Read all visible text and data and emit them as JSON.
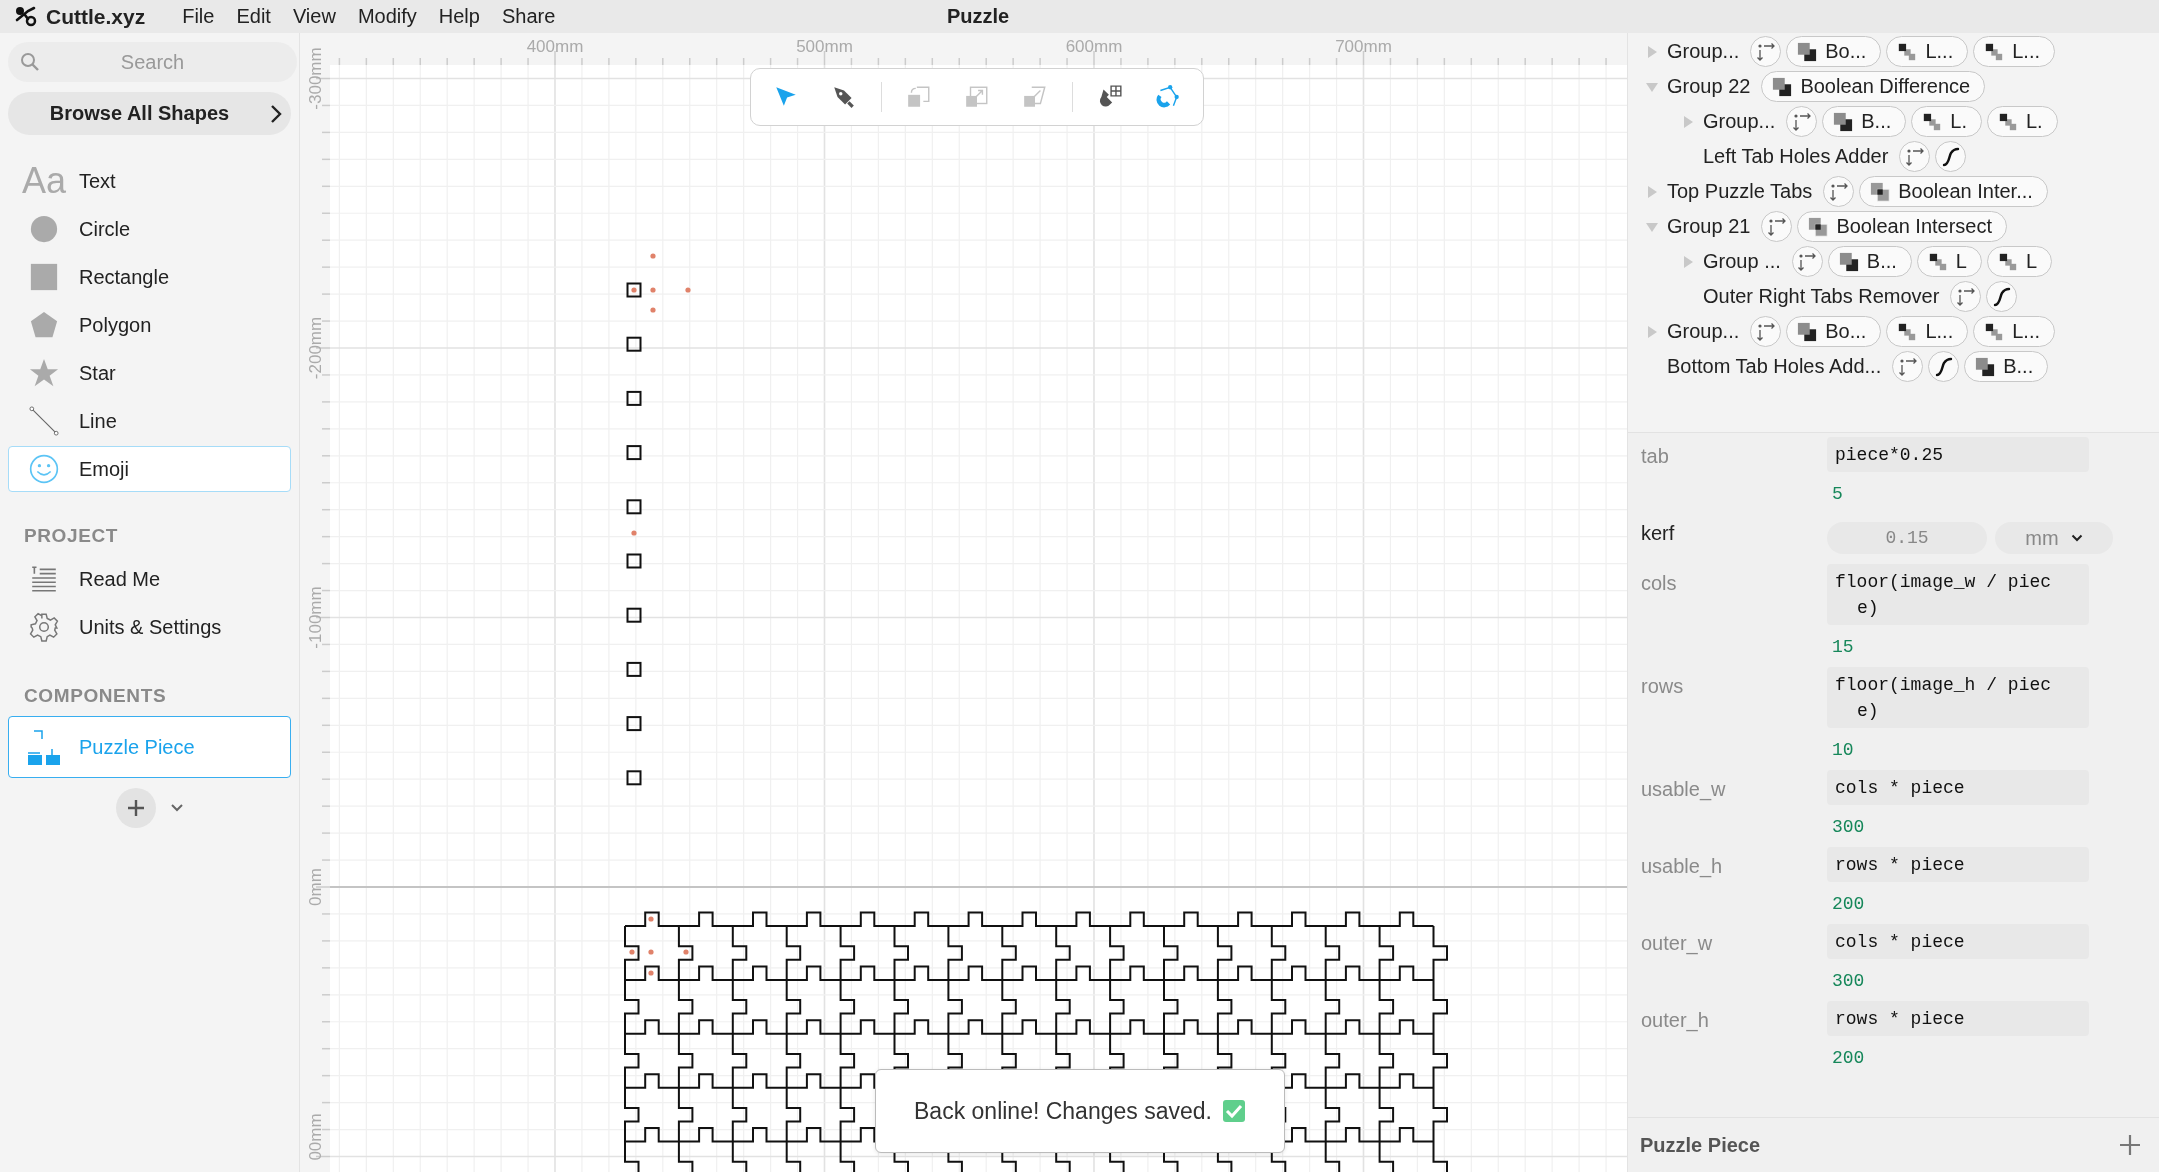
{
  "menu_bar": {
    "app_name": "Cuttle.xyz",
    "menus": [
      "File",
      "Edit",
      "View",
      "Modify",
      "Help",
      "Share"
    ],
    "title": "Puzzle"
  },
  "sidebar": {
    "search": {
      "placeholder": "Search"
    },
    "browse_button": "Browse All Shapes",
    "shapes": [
      {
        "kind": "text",
        "glyph": "Aa",
        "label": "Text",
        "selected": false
      },
      {
        "kind": "circle",
        "label": "Circle",
        "selected": false
      },
      {
        "kind": "rectangle",
        "label": "Rectangle",
        "selected": false
      },
      {
        "kind": "polygon",
        "label": "Polygon",
        "selected": false
      },
      {
        "kind": "star",
        "label": "Star",
        "selected": false
      },
      {
        "kind": "line",
        "label": "Line",
        "selected": false
      },
      {
        "kind": "emoji",
        "label": "Emoji",
        "selected": true
      }
    ],
    "project_heading": "PROJECT",
    "project_items": [
      {
        "kind": "readme",
        "label": "Read Me"
      },
      {
        "kind": "settings",
        "label": "Units & Settings"
      }
    ],
    "components_heading": "COMPONENTS",
    "components": [
      {
        "label": "Puzzle Piece",
        "selected": true
      }
    ]
  },
  "canvas": {
    "ruler_x": [
      "400mm",
      "500mm",
      "600mm",
      "700mm"
    ],
    "ruler_y": [
      "-300mm",
      "-200mm",
      "-100mm",
      "0mm",
      "00mm"
    ],
    "toolbar": [
      {
        "kind": "select",
        "selected": true
      },
      {
        "kind": "pen",
        "selected": false
      },
      {
        "kind": "separator"
      },
      {
        "kind": "rotate-copy",
        "disabled": true
      },
      {
        "kind": "scale-copy",
        "disabled": true
      },
      {
        "kind": "skew-copy",
        "disabled": true
      },
      {
        "kind": "separator"
      },
      {
        "kind": "snap-grid",
        "on": false
      },
      {
        "kind": "snap-points",
        "on": true
      }
    ],
    "toast": {
      "message": "Back online! Changes saved."
    }
  },
  "tree": [
    {
      "name": "Group...",
      "expanded": false,
      "chips": [
        {
          "kind": "swap"
        },
        {
          "kind": "difference",
          "label": "Bo..."
        },
        {
          "kind": "repeat",
          "label": "L..."
        },
        {
          "kind": "repeat",
          "label": "L..."
        }
      ]
    },
    {
      "name": "Group 22",
      "expanded": true,
      "chips": [
        {
          "kind": "difference",
          "label": "Boolean Difference"
        }
      ],
      "children": [
        {
          "name": "Group...",
          "expanded": false,
          "chips": [
            {
              "kind": "swap"
            },
            {
              "kind": "difference",
              "label": "B..."
            },
            {
              "kind": "repeat",
              "label": "L."
            },
            {
              "kind": "repeat",
              "label": "L."
            }
          ]
        },
        {
          "name": "Left Tab Holes Adder",
          "chips": [
            {
              "kind": "swap"
            },
            {
              "kind": "curve"
            }
          ]
        }
      ]
    },
    {
      "name": "Top Puzzle Tabs",
      "expanded": false,
      "chips": [
        {
          "kind": "swap"
        },
        {
          "kind": "intersect",
          "label": "Boolean Inter..."
        }
      ]
    },
    {
      "name": "Group 21",
      "expanded": true,
      "chips": [
        {
          "kind": "swap"
        },
        {
          "kind": "intersect",
          "label": "Boolean Intersect"
        }
      ],
      "children": [
        {
          "name": "Group ...",
          "expanded": false,
          "chips": [
            {
              "kind": "swap"
            },
            {
              "kind": "difference",
              "label": "B..."
            },
            {
              "kind": "repeat",
              "label": "L"
            },
            {
              "kind": "repeat",
              "label": "L"
            }
          ]
        },
        {
          "name": "Outer Right Tabs Remover",
          "chips": [
            {
              "kind": "swap"
            },
            {
              "kind": "curve"
            }
          ]
        }
      ]
    },
    {
      "name": "Group...",
      "expanded": false,
      "chips": [
        {
          "kind": "swap"
        },
        {
          "kind": "difference",
          "label": "Bo..."
        },
        {
          "kind": "repeat",
          "label": "L..."
        },
        {
          "kind": "repeat",
          "label": "L..."
        }
      ]
    },
    {
      "name": "Bottom Tab Holes Add...",
      "chips": [
        {
          "kind": "swap"
        },
        {
          "kind": "curve"
        },
        {
          "kind": "difference",
          "label": "B..."
        }
      ]
    }
  ],
  "parameters": [
    {
      "name": "tab",
      "kind": "computed",
      "expression": "piece*0.25",
      "result": "5"
    },
    {
      "name": "kerf",
      "kind": "input",
      "value": "0.15",
      "unit": "mm"
    },
    {
      "name": "cols",
      "kind": "computed",
      "expression": "floor(image_w / piece)",
      "result": "15"
    },
    {
      "name": "rows",
      "kind": "computed",
      "expression": "floor(image_h / piece)",
      "result": "10"
    },
    {
      "name": "usable_w",
      "kind": "computed",
      "expression": "cols * piece",
      "result": "300"
    },
    {
      "name": "usable_h",
      "kind": "computed",
      "expression": "rows * piece",
      "result": "200"
    },
    {
      "name": "outer_w",
      "kind": "computed",
      "expression": "cols * piece",
      "result": "300"
    },
    {
      "name": "outer_h",
      "kind": "computed",
      "expression": "rows * piece",
      "result": "200"
    }
  ],
  "component_header": {
    "title": "Puzzle Piece"
  }
}
